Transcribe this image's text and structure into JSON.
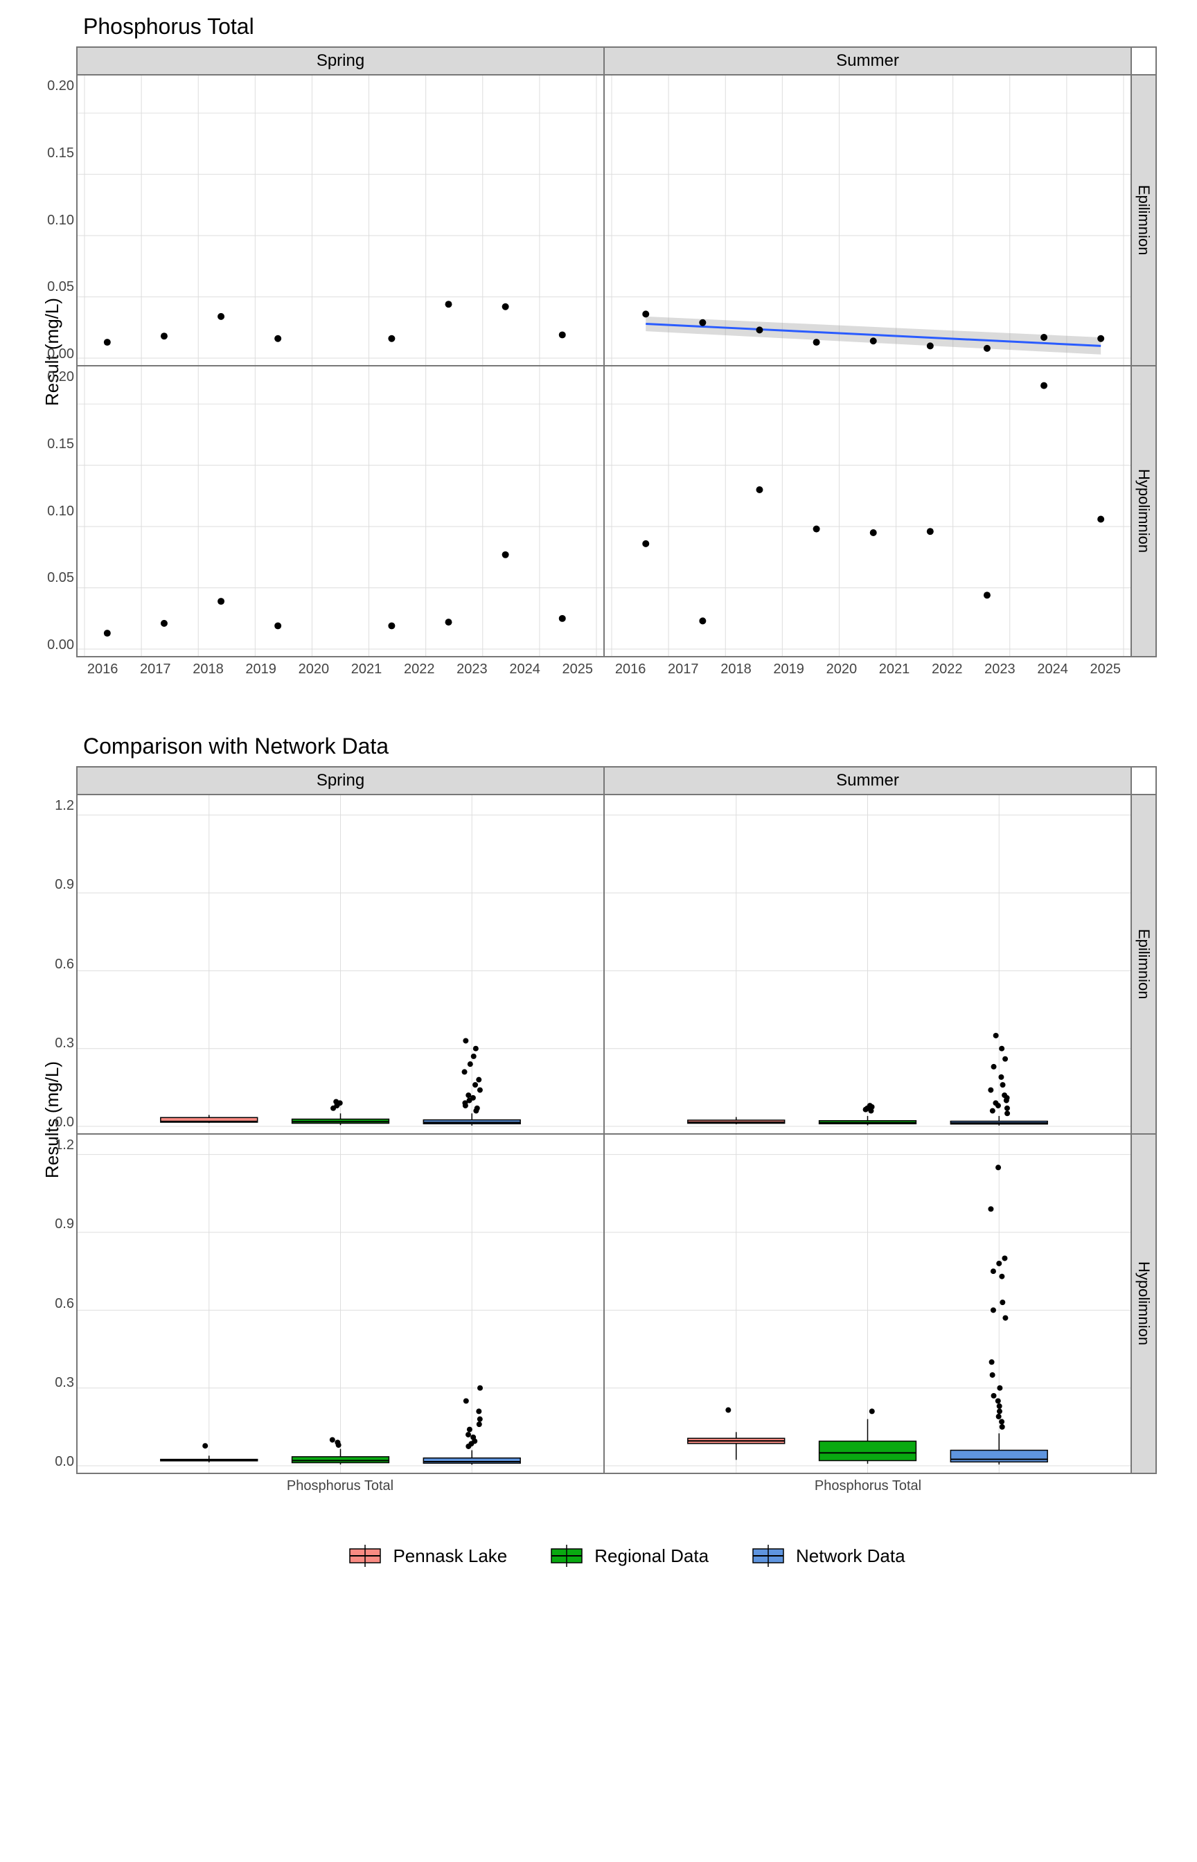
{
  "chart_data": [
    {
      "id": "phosphorus_timeseries",
      "type": "scatter",
      "title": "Phosphorus Total",
      "xlabel": "",
      "ylabel": "Result (mg/L)",
      "x_ticks": [
        2016,
        2017,
        2018,
        2019,
        2020,
        2021,
        2022,
        2023,
        2024,
        2025
      ],
      "y_ticks": [
        0.0,
        0.05,
        0.1,
        0.15,
        0.2
      ],
      "ylim": [
        0,
        0.225
      ],
      "facets_col": [
        "Spring",
        "Summer"
      ],
      "facets_row": [
        "Epilimnion",
        "Hypolimnion"
      ],
      "panels": {
        "Spring|Epilimnion": {
          "points": [
            {
              "x": 2016.4,
              "y": 0.013
            },
            {
              "x": 2017.4,
              "y": 0.018
            },
            {
              "x": 2018.4,
              "y": 0.034
            },
            {
              "x": 2019.4,
              "y": 0.016
            },
            {
              "x": 2021.4,
              "y": 0.016
            },
            {
              "x": 2022.4,
              "y": 0.044
            },
            {
              "x": 2023.4,
              "y": 0.042
            },
            {
              "x": 2024.4,
              "y": 0.019
            }
          ]
        },
        "Summer|Epilimnion": {
          "points": [
            {
              "x": 2016.6,
              "y": 0.036
            },
            {
              "x": 2017.6,
              "y": 0.029
            },
            {
              "x": 2018.6,
              "y": 0.023
            },
            {
              "x": 2019.6,
              "y": 0.013
            },
            {
              "x": 2020.6,
              "y": 0.014
            },
            {
              "x": 2021.6,
              "y": 0.01
            },
            {
              "x": 2022.6,
              "y": 0.008
            },
            {
              "x": 2023.6,
              "y": 0.017
            },
            {
              "x": 2024.6,
              "y": 0.016
            }
          ],
          "trend": {
            "x": [
              2016.6,
              2024.6
            ],
            "y": [
              0.028,
              0.01
            ],
            "ci_upper": [
              0.034,
              0.017
            ],
            "ci_lower": [
              0.022,
              0.003
            ]
          }
        },
        "Spring|Hypolimnion": {
          "points": [
            {
              "x": 2016.4,
              "y": 0.013
            },
            {
              "x": 2017.4,
              "y": 0.021
            },
            {
              "x": 2018.4,
              "y": 0.039
            },
            {
              "x": 2019.4,
              "y": 0.019
            },
            {
              "x": 2021.4,
              "y": 0.019
            },
            {
              "x": 2022.4,
              "y": 0.022
            },
            {
              "x": 2023.4,
              "y": 0.077
            },
            {
              "x": 2024.4,
              "y": 0.025
            }
          ]
        },
        "Summer|Hypolimnion": {
          "points": [
            {
              "x": 2016.6,
              "y": 0.086
            },
            {
              "x": 2017.6,
              "y": 0.023
            },
            {
              "x": 2018.6,
              "y": 0.13
            },
            {
              "x": 2019.6,
              "y": 0.098
            },
            {
              "x": 2020.6,
              "y": 0.095
            },
            {
              "x": 2021.6,
              "y": 0.096
            },
            {
              "x": 2022.6,
              "y": 0.044
            },
            {
              "x": 2023.6,
              "y": 0.215
            },
            {
              "x": 2024.6,
              "y": 0.106
            }
          ]
        }
      }
    },
    {
      "id": "comparison_boxplots",
      "type": "boxplot",
      "title": "Comparison with Network Data",
      "xlabel": "Phosphorus Total",
      "ylabel": "Results (mg/L)",
      "y_ticks": [
        0.0,
        0.3,
        0.6,
        0.9,
        1.2
      ],
      "ylim": [
        0,
        1.25
      ],
      "facets_col": [
        "Spring",
        "Summer"
      ],
      "facets_row": [
        "Epilimnion",
        "Hypolimnion"
      ],
      "groups": [
        "Pennask Lake",
        "Regional Data",
        "Network Data"
      ],
      "colors": {
        "Pennask Lake": "#f98b83",
        "Regional Data": "#09a911",
        "Network Data": "#5f95df"
      },
      "panels": {
        "Spring|Epilimnion": {
          "boxes": [
            {
              "group": "Pennask Lake",
              "min": 0.013,
              "q1": 0.016,
              "med": 0.019,
              "q3": 0.034,
              "max": 0.044,
              "outliers": []
            },
            {
              "group": "Regional Data",
              "min": 0.005,
              "q1": 0.012,
              "med": 0.018,
              "q3": 0.028,
              "max": 0.05,
              "outliers": [
                0.07,
                0.08,
                0.09,
                0.095
              ]
            },
            {
              "group": "Network Data",
              "min": 0.003,
              "q1": 0.01,
              "med": 0.015,
              "q3": 0.025,
              "max": 0.05,
              "outliers": [
                0.06,
                0.07,
                0.08,
                0.09,
                0.1,
                0.11,
                0.12,
                0.14,
                0.16,
                0.18,
                0.21,
                0.24,
                0.27,
                0.3,
                0.33
              ]
            }
          ]
        },
        "Summer|Epilimnion": {
          "boxes": [
            {
              "group": "Pennask Lake",
              "min": 0.008,
              "q1": 0.012,
              "med": 0.016,
              "q3": 0.024,
              "max": 0.036,
              "outliers": []
            },
            {
              "group": "Regional Data",
              "min": 0.004,
              "q1": 0.01,
              "med": 0.014,
              "q3": 0.022,
              "max": 0.04,
              "outliers": [
                0.06,
                0.065,
                0.07,
                0.075,
                0.08
              ]
            },
            {
              "group": "Network Data",
              "min": 0.003,
              "q1": 0.009,
              "med": 0.013,
              "q3": 0.02,
              "max": 0.04,
              "outliers": [
                0.05,
                0.06,
                0.07,
                0.08,
                0.09,
                0.1,
                0.11,
                0.12,
                0.14,
                0.16,
                0.19,
                0.23,
                0.26,
                0.3,
                0.35
              ]
            }
          ]
        },
        "Spring|Hypolimnion": {
          "boxes": [
            {
              "group": "Pennask Lake",
              "min": 0.013,
              "q1": 0.019,
              "med": 0.021,
              "q3": 0.025,
              "max": 0.039,
              "outliers": [
                0.077
              ]
            },
            {
              "group": "Regional Data",
              "min": 0.005,
              "q1": 0.012,
              "med": 0.02,
              "q3": 0.035,
              "max": 0.065,
              "outliers": [
                0.08,
                0.09,
                0.1
              ]
            },
            {
              "group": "Network Data",
              "min": 0.004,
              "q1": 0.01,
              "med": 0.016,
              "q3": 0.03,
              "max": 0.06,
              "outliers": [
                0.075,
                0.085,
                0.095,
                0.11,
                0.12,
                0.14,
                0.16,
                0.18,
                0.21,
                0.25,
                0.3
              ]
            }
          ]
        },
        "Summer|Hypolimnion": {
          "boxes": [
            {
              "group": "Pennask Lake",
              "min": 0.023,
              "q1": 0.086,
              "med": 0.096,
              "q3": 0.106,
              "max": 0.13,
              "outliers": [
                0.215
              ]
            },
            {
              "group": "Regional Data",
              "min": 0.008,
              "q1": 0.02,
              "med": 0.05,
              "q3": 0.095,
              "max": 0.18,
              "outliers": [
                0.21
              ]
            },
            {
              "group": "Network Data",
              "min": 0.005,
              "q1": 0.015,
              "med": 0.025,
              "q3": 0.06,
              "max": 0.125,
              "outliers": [
                0.15,
                0.17,
                0.19,
                0.21,
                0.23,
                0.25,
                0.27,
                0.3,
                0.35,
                0.4,
                0.57,
                0.6,
                0.63,
                0.73,
                0.75,
                0.78,
                0.8,
                0.99,
                1.15
              ]
            }
          ]
        }
      }
    }
  ],
  "legend": {
    "items": [
      {
        "label": "Pennask Lake",
        "color": "#f98b83"
      },
      {
        "label": "Regional Data",
        "color": "#09a911"
      },
      {
        "label": "Network Data",
        "color": "#5f95df"
      }
    ]
  }
}
